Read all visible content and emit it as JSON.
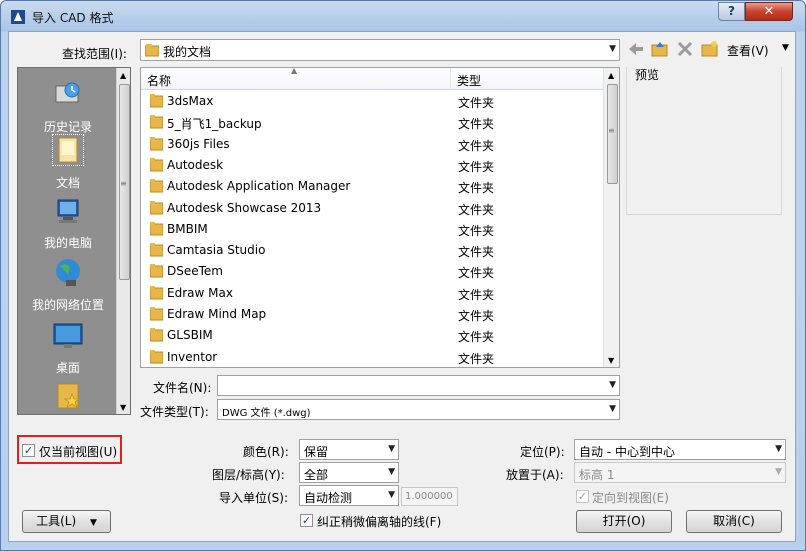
{
  "window": {
    "title": "导入 CAD 格式",
    "help_label": "?",
    "close_label": "✕"
  },
  "lookin": {
    "label": "查找范围(I):",
    "value": "我的文档"
  },
  "toolbar": {
    "back_icon": "back-arrow-icon",
    "up_icon": "up-folder-icon",
    "delete_icon": "delete-icon",
    "newfolder_icon": "new-folder-icon",
    "views_label": "查看(V)"
  },
  "places": [
    {
      "label": "历史记录",
      "icon": "history-icon"
    },
    {
      "label": "文档",
      "icon": "documents-icon"
    },
    {
      "label": "我的电脑",
      "icon": "computer-icon"
    },
    {
      "label": "我的网络位置",
      "icon": "network-icon"
    },
    {
      "label": "桌面",
      "icon": "desktop-icon"
    },
    {
      "label": "",
      "icon": "favorites-icon"
    }
  ],
  "filelist": {
    "col_name": "名称",
    "col_type": "类型",
    "rows": [
      {
        "name": "3dsMax",
        "type": "文件夹"
      },
      {
        "name": "5_肖飞1_backup",
        "type": "文件夹"
      },
      {
        "name": "360js Files",
        "type": "文件夹"
      },
      {
        "name": "Autodesk",
        "type": "文件夹"
      },
      {
        "name": "Autodesk Application Manager",
        "type": "文件夹"
      },
      {
        "name": "Autodesk Showcase 2013",
        "type": "文件夹"
      },
      {
        "name": "BMBIM",
        "type": "文件夹"
      },
      {
        "name": "Camtasia Studio",
        "type": "文件夹"
      },
      {
        "name": "DSeeTem",
        "type": "文件夹"
      },
      {
        "name": "Edraw Max",
        "type": "文件夹"
      },
      {
        "name": "Edraw Mind Map",
        "type": "文件夹"
      },
      {
        "name": "GLSBIM",
        "type": "文件夹"
      },
      {
        "name": "Inventor",
        "type": "文件夹"
      }
    ]
  },
  "preview": {
    "label": "预览"
  },
  "filename": {
    "label": "文件名(N):",
    "value": ""
  },
  "filetype": {
    "label": "文件类型(T):",
    "value": "DWG 文件 (*.dwg)"
  },
  "options": {
    "current_view_only": {
      "label": "仅当前视图(U)",
      "checked": true
    },
    "color": {
      "label": "颜色(R):",
      "value": "保留"
    },
    "layers": {
      "label": "图层/标高(Y):",
      "value": "全部"
    },
    "units": {
      "label": "导入单位(S):",
      "value": "自动检测",
      "factor": "1.000000"
    },
    "correct_lines": {
      "label": "纠正稍微偏离轴的线(F)",
      "checked": true
    },
    "positioning": {
      "label": "定位(P):",
      "value": "自动 - 中心到中心"
    },
    "place_at": {
      "label": "放置于(A):",
      "value": "标高 1"
    },
    "orient": {
      "label": "定向到视图(E)",
      "checked": true
    }
  },
  "buttons": {
    "tools": "工具(L)",
    "open": "打开(O)",
    "cancel": "取消(C)"
  },
  "colors": {
    "accent_red": "#e02020",
    "folder": "#e8b74a",
    "selection": "#1c3d6f"
  }
}
